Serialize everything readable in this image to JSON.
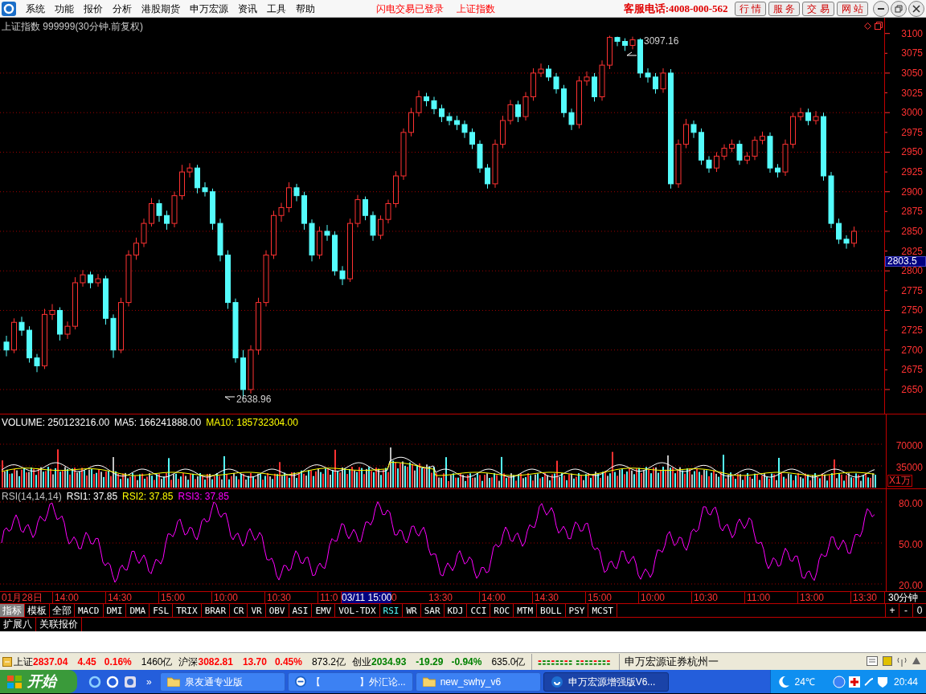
{
  "menu_bar": {
    "items": [
      "系统",
      "功能",
      "报价",
      "分析",
      "港股期货",
      "申万宏源",
      "资讯",
      "工具",
      "帮助"
    ],
    "notices": [
      "闪电交易已登录",
      "上证指数"
    ],
    "hotline": "客服电话:4008-000-562",
    "buttons": [
      "行 情",
      "服 务",
      "交 易",
      "网 站"
    ]
  },
  "price_panel": {
    "title": "上证指数 999999(30分钟.前复权)",
    "chart_data": {
      "type": "candlestick",
      "ylim": [
        2618.5,
        3120
      ],
      "grid": true,
      "yticks": [
        3100,
        3075,
        3050,
        3025,
        3000,
        2975,
        2950,
        2925,
        2900,
        2875,
        2850,
        2825,
        2800,
        2775,
        2750,
        2725,
        2700,
        2675,
        2650
      ],
      "ohlc": [
        [
          2710,
          2718,
          2692,
          2700
        ],
        [
          2700,
          2740,
          2696,
          2735
        ],
        [
          2735,
          2742,
          2718,
          2725
        ],
        [
          2725,
          2730,
          2684,
          2690
        ],
        [
          2690,
          2695,
          2672,
          2680
        ],
        [
          2680,
          2752,
          2676,
          2745
        ],
        [
          2745,
          2758,
          2738,
          2750
        ],
        [
          2750,
          2754,
          2712,
          2720
        ],
        [
          2720,
          2736,
          2714,
          2730
        ],
        [
          2730,
          2792,
          2726,
          2785
        ],
        [
          2785,
          2801,
          2780,
          2795
        ],
        [
          2795,
          2799,
          2778,
          2785
        ],
        [
          2785,
          2796,
          2780,
          2790
        ],
        [
          2790,
          2794,
          2732,
          2740
        ],
        [
          2740,
          2745,
          2690,
          2700
        ],
        [
          2700,
          2766,
          2696,
          2760
        ],
        [
          2760,
          2826,
          2755,
          2820
        ],
        [
          2820,
          2842,
          2814,
          2835
        ],
        [
          2835,
          2866,
          2830,
          2860
        ],
        [
          2860,
          2892,
          2856,
          2885
        ],
        [
          2885,
          2890,
          2862,
          2870
        ],
        [
          2870,
          2876,
          2852,
          2860
        ],
        [
          2860,
          2900,
          2855,
          2895
        ],
        [
          2895,
          2934,
          2890,
          2925
        ],
        [
          2925,
          2936,
          2918,
          2930
        ],
        [
          2930,
          2934,
          2898,
          2905
        ],
        [
          2905,
          2912,
          2894,
          2900
        ],
        [
          2900,
          2904,
          2852,
          2860
        ],
        [
          2860,
          2866,
          2812,
          2820
        ],
        [
          2820,
          2826,
          2752,
          2760
        ],
        [
          2760,
          2765,
          2684,
          2690
        ],
        [
          2690,
          2700,
          2638.96,
          2650
        ],
        [
          2650,
          2706,
          2645,
          2700
        ],
        [
          2700,
          2766,
          2694,
          2760
        ],
        [
          2760,
          2826,
          2755,
          2820
        ],
        [
          2820,
          2876,
          2815,
          2870
        ],
        [
          2870,
          2886,
          2862,
          2880
        ],
        [
          2880,
          2912,
          2874,
          2905
        ],
        [
          2905,
          2910,
          2888,
          2895
        ],
        [
          2895,
          2900,
          2852,
          2860
        ],
        [
          2860,
          2865,
          2812,
          2820
        ],
        [
          2820,
          2856,
          2815,
          2850
        ],
        [
          2850,
          2858,
          2838,
          2845
        ],
        [
          2845,
          2850,
          2794,
          2800
        ],
        [
          2800,
          2806,
          2782,
          2790
        ],
        [
          2790,
          2866,
          2786,
          2860
        ],
        [
          2860,
          2896,
          2855,
          2890
        ],
        [
          2890,
          2894,
          2864,
          2870
        ],
        [
          2870,
          2875,
          2838,
          2845
        ],
        [
          2845,
          2870,
          2840,
          2865
        ],
        [
          2865,
          2890,
          2860,
          2885
        ],
        [
          2885,
          2926,
          2880,
          2920
        ],
        [
          2920,
          2980,
          2915,
          2975
        ],
        [
          2975,
          3006,
          2970,
          3000
        ],
        [
          3000,
          3028,
          2995,
          3020
        ],
        [
          3020,
          3025,
          3008,
          3015
        ],
        [
          3015,
          3020,
          2998,
          3005
        ],
        [
          3005,
          3010,
          2988,
          2995
        ],
        [
          2995,
          3000,
          2984,
          2990
        ],
        [
          2990,
          2996,
          2978,
          2985
        ],
        [
          2985,
          2990,
          2968,
          2975
        ],
        [
          2975,
          2980,
          2954,
          2960
        ],
        [
          2960,
          2965,
          2924,
          2930
        ],
        [
          2930,
          2935,
          2904,
          2910
        ],
        [
          2910,
          2966,
          2905,
          2960
        ],
        [
          2960,
          2996,
          2955,
          2990
        ],
        [
          2990,
          3016,
          2985,
          3010
        ],
        [
          3010,
          3015,
          2988,
          2995
        ],
        [
          2995,
          3026,
          2990,
          3020
        ],
        [
          3020,
          3056,
          3015,
          3050
        ],
        [
          3050,
          3062,
          3045,
          3055
        ],
        [
          3055,
          3060,
          3040,
          3045
        ],
        [
          3045,
          3050,
          3024,
          3030
        ],
        [
          3030,
          3035,
          2994,
          3000
        ],
        [
          3000,
          3005,
          2978,
          2985
        ],
        [
          2985,
          3046,
          2980,
          3040
        ],
        [
          3040,
          3052,
          3034,
          3045
        ],
        [
          3045,
          3050,
          3014,
          3020
        ],
        [
          3020,
          3066,
          3015,
          3060
        ],
        [
          3060,
          3097.16,
          3055,
          3095
        ],
        [
          3095,
          3096,
          3084,
          3090
        ],
        [
          3090,
          3094,
          3078,
          3085
        ],
        [
          3085,
          3096,
          3080,
          3092
        ],
        [
          3092,
          3094,
          3044,
          3050
        ],
        [
          3050,
          3056,
          3038,
          3045
        ],
        [
          3045,
          3050,
          3024,
          3030
        ],
        [
          3030,
          3056,
          3025,
          3050
        ],
        [
          3050,
          3055,
          2904,
          2910
        ],
        [
          2910,
          2966,
          2905,
          2960
        ],
        [
          2960,
          2992,
          2955,
          2985
        ],
        [
          2985,
          2990,
          2968,
          2975
        ],
        [
          2975,
          2980,
          2934,
          2940
        ],
        [
          2940,
          2945,
          2924,
          2930
        ],
        [
          2930,
          2950,
          2925,
          2945
        ],
        [
          2945,
          2960,
          2940,
          2955
        ],
        [
          2955,
          2966,
          2950,
          2960
        ],
        [
          2960,
          2965,
          2934,
          2940
        ],
        [
          2940,
          2950,
          2935,
          2945
        ],
        [
          2945,
          2970,
          2940,
          2965
        ],
        [
          2965,
          2976,
          2960,
          2970
        ],
        [
          2970,
          2975,
          2924,
          2930
        ],
        [
          2930,
          2935,
          2918,
          2925
        ],
        [
          2925,
          2966,
          2920,
          2960
        ],
        [
          2960,
          3000,
          2955,
          2995
        ],
        [
          2995,
          3006,
          2990,
          3000
        ],
        [
          3000,
          3005,
          2984,
          2990
        ],
        [
          2990,
          3002,
          2985,
          2995
        ],
        [
          2995,
          3000,
          2914,
          2920
        ],
        [
          2920,
          2925,
          2854,
          2860
        ],
        [
          2860,
          2866,
          2834,
          2840
        ],
        [
          2840,
          2845,
          2828,
          2835
        ],
        [
          2835,
          2856,
          2830,
          2850
        ]
      ]
    },
    "current_price": "2803.5",
    "annotations": [
      "3097.16",
      "2638.96"
    ]
  },
  "volume_panel": {
    "readings": [
      {
        "text": "VOLUME: 250123216.00",
        "color": "#ffffff"
      },
      {
        "text": "MA5: 166241888.00",
        "color": "#ffffff"
      },
      {
        "text": "MA10: 185732304.00",
        "color": "#ffff00"
      }
    ],
    "axis_labels": [
      "70000",
      "35000"
    ],
    "unit": "X1万"
  },
  "rsi_panel": {
    "readings": [
      {
        "text": "RSI(14,14,14)",
        "color": "#c0c0c0"
      },
      {
        "text": "RSI1: 37.85",
        "color": "#ffffff"
      },
      {
        "text": "RSI2: 37.85",
        "color": "#ffff00"
      },
      {
        "text": "RSI3: 37.85",
        "color": "#ff00ff"
      }
    ],
    "axis_labels": [
      "80.00",
      "50.00",
      "20.00"
    ]
  },
  "time_axis": {
    "labels": [
      {
        "text": "01月28日",
        "kind": "date"
      },
      {
        "text": "14:00",
        "kind": "tick"
      },
      {
        "text": "14:30",
        "kind": "tick"
      },
      {
        "text": "15:00",
        "kind": "tick"
      },
      {
        "text": "10:00",
        "kind": "tick"
      },
      {
        "text": "10:30",
        "kind": "tick"
      },
      {
        "text": "11:0",
        "kind": "cut"
      },
      {
        "text": "03/11 15:00",
        "kind": "cursor"
      },
      {
        "text": "0",
        "kind": "tail"
      },
      {
        "text": "13:30",
        "kind": "tick"
      },
      {
        "text": "14:00",
        "kind": "tick"
      },
      {
        "text": "14:30",
        "kind": "tick"
      },
      {
        "text": "15:00",
        "kind": "tick"
      },
      {
        "text": "10:00",
        "kind": "tick"
      },
      {
        "text": "10:30",
        "kind": "tick"
      },
      {
        "text": "11:00",
        "kind": "tick"
      },
      {
        "text": "13:00",
        "kind": "tick"
      },
      {
        "text": "13:30",
        "kind": "tick"
      }
    ],
    "period": "30分钟"
  },
  "mode_tabs": [
    {
      "label": "指标",
      "selected": true
    },
    {
      "label": "模板",
      "selected": false
    },
    {
      "label": "全部",
      "selected": false
    }
  ],
  "indicator_tabs": [
    {
      "label": "MACD",
      "selected": false
    },
    {
      "label": "DMI",
      "selected": false
    },
    {
      "label": "DMA",
      "selected": false
    },
    {
      "label": "FSL",
      "selected": false
    },
    {
      "label": "TRIX",
      "selected": false
    },
    {
      "label": "BRAR",
      "selected": false
    },
    {
      "label": "CR",
      "selected": false
    },
    {
      "label": "VR",
      "selected": false
    },
    {
      "label": "OBV",
      "selected": false
    },
    {
      "label": "ASI",
      "selected": false
    },
    {
      "label": "EMV",
      "selected": false
    },
    {
      "label": "VOL-TDX",
      "selected": false
    },
    {
      "label": "RSI",
      "selected": true
    },
    {
      "label": "WR",
      "selected": false
    },
    {
      "label": "SAR",
      "selected": false
    },
    {
      "label": "KDJ",
      "selected": false
    },
    {
      "label": "CCI",
      "selected": false
    },
    {
      "label": "ROC",
      "selected": false
    },
    {
      "label": "MTM",
      "selected": false
    },
    {
      "label": "BOLL",
      "selected": false
    },
    {
      "label": "PSY",
      "selected": false
    },
    {
      "label": "MCST",
      "selected": false
    }
  ],
  "zoom_buttons": [
    "+",
    "-",
    "0"
  ],
  "extra_tabs": [
    "扩展八",
    "关联报价"
  ],
  "status_bar": {
    "indices": [
      {
        "name": "上证",
        "price": "2837.04",
        "change": "4.45",
        "percent": "0.16%",
        "amount": "1460亿",
        "color": "#ff0000"
      },
      {
        "name": "沪深",
        "price": "3082.81",
        "change": "13.70",
        "percent": "0.45%",
        "amount": "873.2亿",
        "color": "#ff0000"
      },
      {
        "name": "创业",
        "price": "2034.93",
        "change": "-19.29",
        "percent": "-0.94%",
        "amount": "635.0亿",
        "color": "#008000"
      }
    ],
    "broker": "申万宏源证券杭州一"
  },
  "taskbar": {
    "start": "开始",
    "more": "»",
    "tasks": [
      {
        "label": "泉友通专业版",
        "kind": "folder",
        "selected": false
      },
      {
        "label": "【　　　　】外汇论...",
        "kind": "browser",
        "selected": false
      },
      {
        "label": "new_swhy_v6",
        "kind": "folder",
        "selected": false
      },
      {
        "label": "申万宏源增强版V6...",
        "kind": "app",
        "selected": true
      }
    ],
    "temperature": "24℃",
    "clock": "20:44"
  }
}
